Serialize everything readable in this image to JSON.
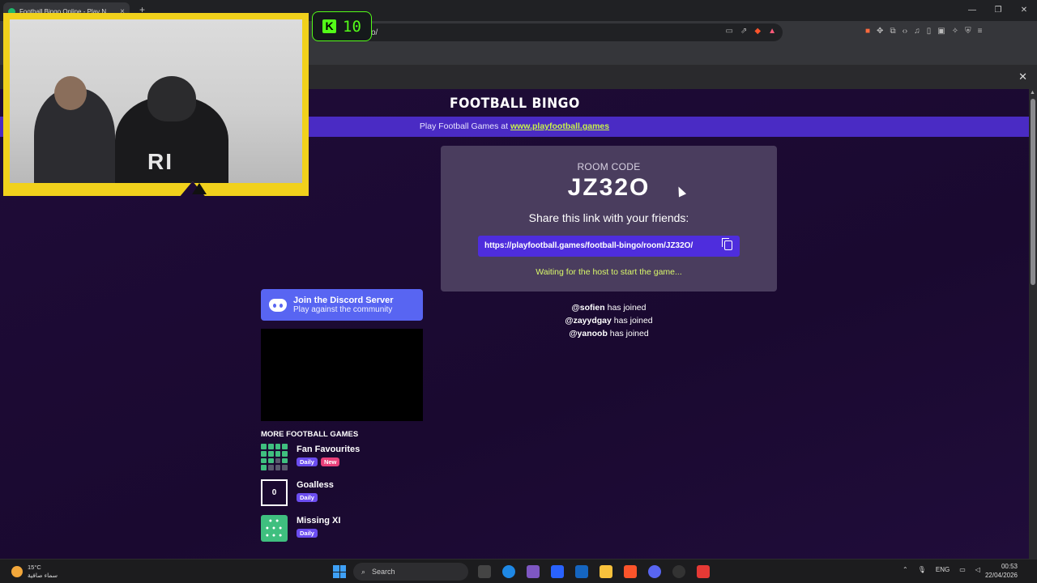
{
  "browser": {
    "tab_title": "Football Bingo Online - Play N",
    "tab_close": "×",
    "new_tab": "+",
    "url_visible": "o/",
    "window_controls": [
      "—",
      "❐",
      "✕"
    ],
    "infobar_close": "✕"
  },
  "site": {
    "title": "FOOTBALL BINGO",
    "banner_prefix": "Play Football Games at ",
    "banner_link": "www.playfootball.games"
  },
  "room": {
    "label": "ROOM CODE",
    "code": "JZ32O",
    "share_text": "Share this link with your friends:",
    "share_link": "https://playfootball.games/football-bingo/room/JZ32O/",
    "waiting": "Waiting for the host to start the game..."
  },
  "players": [
    {
      "name": "@sofien",
      "status": " has joined"
    },
    {
      "name": "@zayydgay",
      "status": " has joined"
    },
    {
      "name": "@yanoob",
      "status": " has joined"
    }
  ],
  "discord": {
    "title": "Join the Discord Server",
    "subtitle": "Play against the community"
  },
  "more_games": {
    "heading": "MORE FOOTBALL GAMES",
    "games": [
      {
        "name": "Fan Favourites",
        "badge1": "Daily",
        "badge2": "New"
      },
      {
        "name": "Goalless",
        "badge1": "Daily",
        "icon_text": "0"
      },
      {
        "name": "Missing XI",
        "badge1": "Daily"
      }
    ]
  },
  "overlay": {
    "kick_value": "10",
    "kick_logo": "K",
    "cam_text": "RI"
  },
  "taskbar": {
    "temperature": "15°C",
    "weather_desc": "سماء صافية",
    "search_placeholder": "Search",
    "language": "ENG",
    "time": "00:53",
    "date": "22/04/2026"
  },
  "colors": {
    "page_bg": "#1d0b33",
    "banner": "#4a2bc4",
    "room_card": "#4a3d5e",
    "share_button": "#4e2ddd",
    "accent_green": "#d9f76a",
    "discord": "#5865f2",
    "kick_green": "#53fc18",
    "webcam_frame": "#f1d11c"
  }
}
